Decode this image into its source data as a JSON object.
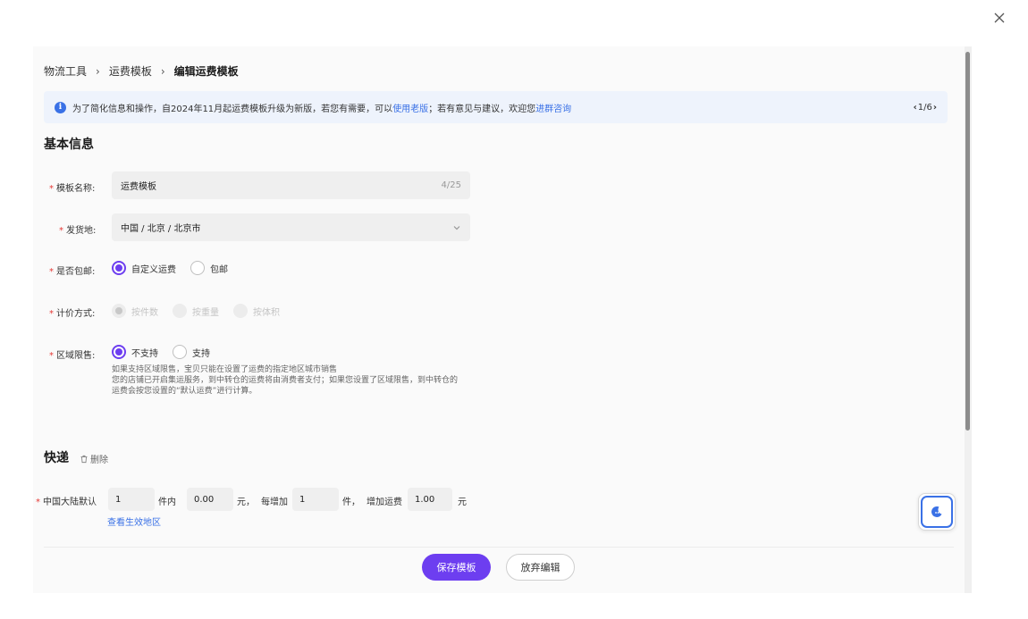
{
  "breadcrumb": {
    "items": [
      "物流工具",
      "运费模板"
    ],
    "current": "编辑运费模板",
    "separator": "›"
  },
  "notice": {
    "text_before": "为了简化信息和操作，自2024年11月起运费模板升级为新版，若您有需要，可以",
    "link_old": "使用老版",
    "text_middle": "；若有意见与建议，欢迎您 ",
    "link_group": "进群咨询",
    "pager": "1/6"
  },
  "basic_info": {
    "title": "基本信息",
    "template_name": {
      "label": "模板名称:",
      "value": "运费模板",
      "count": "4/25"
    },
    "ship_from": {
      "label": "发货地:",
      "value": "中国 / 北京 / 北京市"
    },
    "free_shipping": {
      "label": "是否包邮:",
      "options": [
        "自定义运费",
        "包邮"
      ],
      "selected": "自定义运费"
    },
    "pricing": {
      "label": "计价方式:",
      "options": [
        "按件数",
        "按重量",
        "按体积"
      ],
      "selected": "按件数",
      "disabled": true
    },
    "region_limit": {
      "label": "区域限售:",
      "options": [
        "不支持",
        "支持"
      ],
      "selected": "不支持",
      "hint_lines": [
        "如果支持区域限售，宝贝只能在设置了运费的指定地区城市销售",
        "您的店铺已开启集运服务，到中转仓的运费将由消费者支付；如果您设置了区域限售，到中转仓的",
        "运费会按您设置的“默认运费”进行计算。"
      ]
    }
  },
  "express": {
    "title": "快递",
    "delete_label": "删除",
    "row_label": "中国大陆默认",
    "first_qty": "1",
    "text_within": "件内",
    "first_fee": "0.00",
    "text_yuan_comma": "元，",
    "text_each_add": "每增加",
    "add_qty": "1",
    "text_piece_comma": "件，",
    "text_add_fee": "增加运费",
    "add_fee": "1.00",
    "text_yuan": "元",
    "view_regions": "查看生效地区"
  },
  "footer": {
    "save_label": "保存模板",
    "discard_label": "放弃编辑"
  },
  "colors": {
    "primary": "#6d3ef0",
    "link": "#3a71e6",
    "required": "#e53935",
    "notice_bg": "#eef3fc"
  },
  "icons": {
    "close": "close-icon",
    "info": "info-icon",
    "chevron": "chevron-down-icon",
    "trash": "trash-icon",
    "assistant": "moon-chat-icon"
  }
}
